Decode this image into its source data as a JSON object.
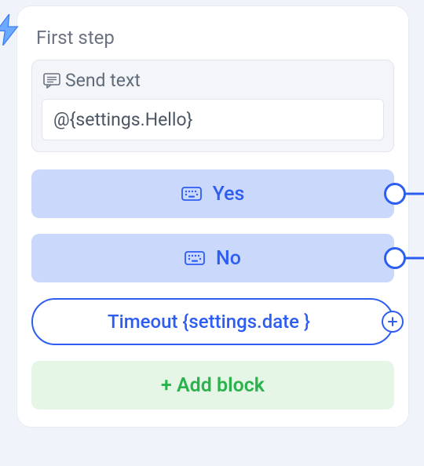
{
  "card": {
    "title": "First step"
  },
  "send": {
    "header": "Send text",
    "value": "@{settings.Hello}"
  },
  "options": [
    {
      "label": "Yes"
    },
    {
      "label": "No"
    }
  ],
  "timeout": {
    "label": "Timeout {settings.date }"
  },
  "addBlock": {
    "label": "+ Add block"
  },
  "colors": {
    "primary": "#2e5df2",
    "optionBg": "#c9d8fb",
    "addBg": "#e5f6e6",
    "addText": "#2bb24c"
  }
}
